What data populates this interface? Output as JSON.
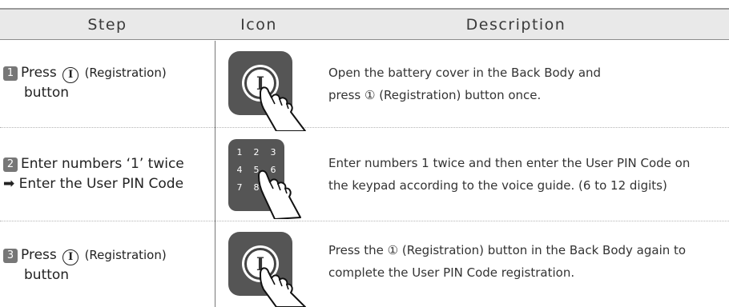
{
  "header": {
    "step": "Step",
    "icon": "Icon",
    "description": "Description"
  },
  "rows": [
    {
      "number": "1",
      "step_prefix": "Press",
      "step_symbol": "I",
      "step_suffix": "(Registration)",
      "step_line2": "button",
      "icon": "registration-button-press-icon",
      "desc_line1": "Open the battery cover in the Back Body and",
      "desc_line2": "press ① (Registration) button once."
    },
    {
      "number": "2",
      "step_line1": "Enter numbers ‘1’ twice",
      "step_line2": "➡ Enter the User PIN Code",
      "icon": "keypad-press-icon",
      "keypad_digits": [
        "1",
        "2",
        "3",
        "4",
        "5",
        "6",
        "7",
        "8"
      ],
      "desc_line1": "Enter numbers 1 twice and then enter the User PIN Code on",
      "desc_line2": "the keypad according to the voice guide. (6 to 12 digits)"
    },
    {
      "number": "3",
      "step_prefix": "Press",
      "step_symbol": "I",
      "step_suffix": "(Registration)",
      "step_line2": "button",
      "icon": "registration-button-press-icon",
      "desc_line1": "Press the ① (Registration) button in the Back Body again to",
      "desc_line2": "complete the User PIN Code registration."
    }
  ]
}
